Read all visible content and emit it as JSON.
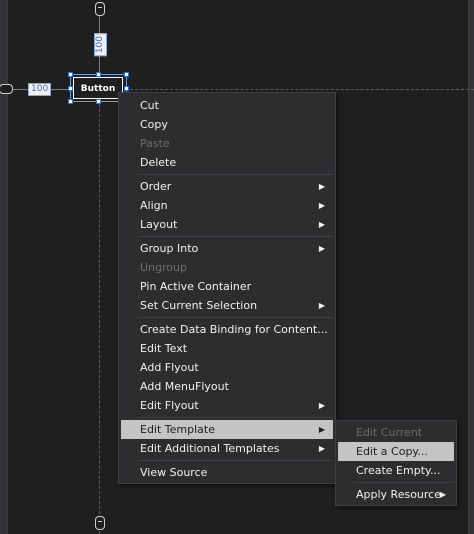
{
  "designer": {
    "margin_top": "100",
    "margin_left": "100",
    "button_label": "Button"
  },
  "context_menu": {
    "items": [
      {
        "label": "Cut",
        "enabled": true,
        "submenu": false
      },
      {
        "label": "Copy",
        "enabled": true,
        "submenu": false
      },
      {
        "label": "Paste",
        "enabled": false,
        "submenu": false
      },
      {
        "label": "Delete",
        "enabled": true,
        "submenu": false
      },
      {
        "label": "Order",
        "enabled": true,
        "submenu": true
      },
      {
        "label": "Align",
        "enabled": true,
        "submenu": true
      },
      {
        "label": "Layout",
        "enabled": true,
        "submenu": true
      },
      {
        "label": "Group Into",
        "enabled": true,
        "submenu": true
      },
      {
        "label": "Ungroup",
        "enabled": false,
        "submenu": false
      },
      {
        "label": "Pin Active Container",
        "enabled": true,
        "submenu": false
      },
      {
        "label": "Set Current Selection",
        "enabled": true,
        "submenu": true
      },
      {
        "label": "Create Data Binding for Content...",
        "enabled": true,
        "submenu": false
      },
      {
        "label": "Edit Text",
        "enabled": true,
        "submenu": false
      },
      {
        "label": "Add Flyout",
        "enabled": true,
        "submenu": false
      },
      {
        "label": "Add MenuFlyout",
        "enabled": true,
        "submenu": false
      },
      {
        "label": "Edit Flyout",
        "enabled": true,
        "submenu": true
      },
      {
        "label": "Edit Template",
        "enabled": true,
        "submenu": true
      },
      {
        "label": "Edit Additional Templates",
        "enabled": true,
        "submenu": true
      },
      {
        "label": "View Source",
        "enabled": true,
        "submenu": false
      }
    ]
  },
  "template_submenu": {
    "items": [
      {
        "label": "Edit Current",
        "enabled": false,
        "submenu": false
      },
      {
        "label": "Edit a Copy...",
        "enabled": true,
        "submenu": false
      },
      {
        "label": "Create Empty...",
        "enabled": true,
        "submenu": false
      },
      {
        "label": "Apply Resource",
        "enabled": true,
        "submenu": true
      }
    ]
  },
  "colors": {
    "menu_background": "#2d2d30",
    "highlight": "#c4c4c4",
    "guide": "#5a5a8a",
    "selection": "#6aa0e0"
  }
}
